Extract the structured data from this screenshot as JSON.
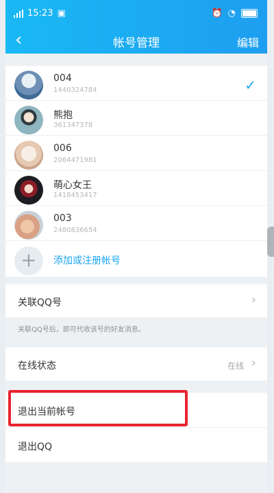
{
  "status_bar": {
    "time": "15:23"
  },
  "nav": {
    "back": "‹",
    "title": "帐号管理",
    "edit": "编辑"
  },
  "accounts": [
    {
      "name": "004",
      "number": "1440324784",
      "selected": true
    },
    {
      "name": "熊抱",
      "number": "361347378",
      "selected": false
    },
    {
      "name": "006",
      "number": "2064471981",
      "selected": false
    },
    {
      "name": "萌心女王",
      "number": "1418453417",
      "selected": false
    },
    {
      "name": "003",
      "number": "2480836654",
      "selected": false
    }
  ],
  "add_account": {
    "label": "添加或注册帐号"
  },
  "linked_qq": {
    "label": "关联QQ号",
    "hint": "关联QQ号后，即可代收该号的好友消息。"
  },
  "online_status": {
    "label": "在线状态",
    "value": "在线"
  },
  "logout_current": {
    "label": "退出当前帐号"
  },
  "logout_qq": {
    "label": "退出QQ"
  },
  "colors": {
    "accent": "#1aa5f0",
    "header": "#1e9ef0",
    "highlight": "#e9232f"
  }
}
